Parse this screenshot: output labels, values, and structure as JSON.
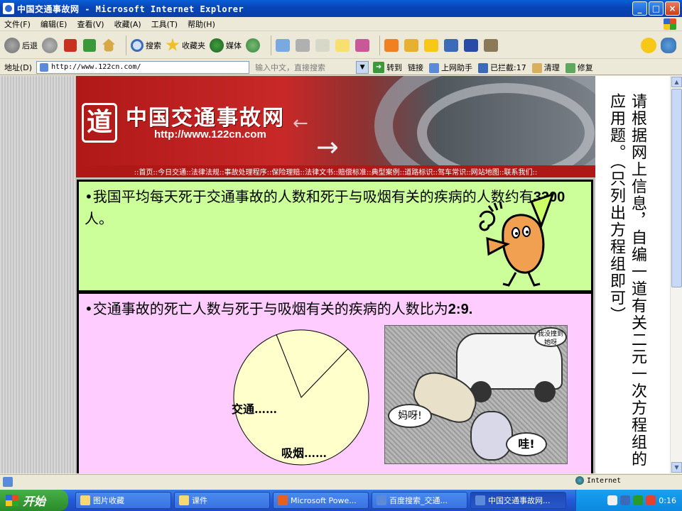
{
  "window": {
    "title": "中国交通事故网 - Microsoft Internet Explorer",
    "minimize": "_",
    "maximize": "□",
    "close": "×"
  },
  "menu": [
    "文件(F)",
    "编辑(E)",
    "查看(V)",
    "收藏(A)",
    "工具(T)",
    "帮助(H)"
  ],
  "toolbar": {
    "back": "后退",
    "search": "搜索",
    "favorites": "收藏夹",
    "media": "媒体"
  },
  "address": {
    "label": "地址(D)",
    "url": "http://www.122cn.com/",
    "ime_hint": "输入中文，直接搜索",
    "go": "转到",
    "links": "链接",
    "helper": "上网助手",
    "blocked": "已拦截:17",
    "clean": "清理",
    "repair": "修复"
  },
  "banner": {
    "logo_char": "道",
    "site_name": "中国交通事故网",
    "url": "http://www.122cn.com",
    "nav": "::首页::今日交通::法律法规::事故处理程序::保险理赔::法律文书::赔偿标准::典型案例::道路标识::驾车常识::网站地图::联系我们::"
  },
  "slide": {
    "top_text_a": "•我国平均每天死于交通事故的人数和死于与吸烟有关的疾病的人数约有",
    "top_number": "3300",
    "top_text_b": "人。",
    "bottom_text_a": "•交通事故的死亡人数与死于与吸烟有关的疾病的人数比为",
    "bottom_ratio": "2:9.",
    "pie_label_traffic": "交通……",
    "pie_label_smoking": "吸烟……",
    "comic_bubble_1": "妈呀!",
    "comic_bubble_2": "哇!",
    "comic_bubble_3": "我没撞到她呀",
    "instruction": "请根据网上信息，自编一道有关二元一次方程组的应用题。（只列出方程组即可）"
  },
  "chart_data": {
    "type": "pie",
    "categories": [
      "交通……",
      "吸烟……"
    ],
    "values": [
      2,
      9
    ],
    "title": ""
  },
  "status": {
    "zone": "Internet"
  },
  "taskbar": {
    "start": "开始",
    "tasks": [
      "图片收藏",
      "课件",
      "Microsoft Powe...",
      "百度搜索_交通...",
      "中国交通事故网..."
    ],
    "clock": "0:16"
  },
  "colors": {
    "panel_top_bg": "#ccff99",
    "panel_bottom_bg": "#ffccff",
    "banner_red": "#b01818",
    "pie_fill": "#ffffcc"
  }
}
